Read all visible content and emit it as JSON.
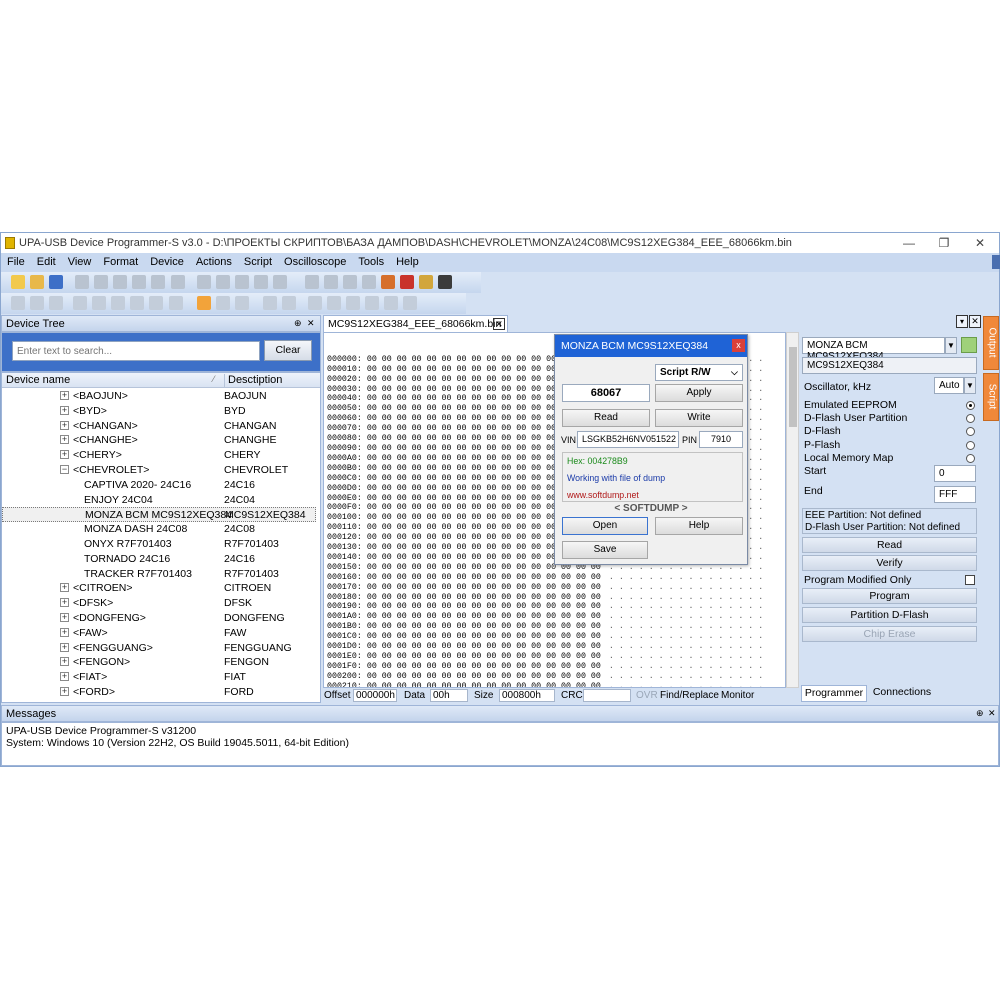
{
  "window": {
    "title": "UPA-USB Device Programmer-S v3.0 - D:\\ПРОЕКТЫ СКРИПТОВ\\БАЗА ДАМПОВ\\DASH\\CHEVROLET\\MONZA\\24C08\\MC9S12XEG384_EEE_68066km.bin",
    "minimize": "—",
    "maximize": "❐",
    "close": "✕"
  },
  "menu": [
    "File",
    "Edit",
    "View",
    "Format",
    "Device",
    "Actions",
    "Script",
    "Oscilloscope",
    "Tools",
    "Help"
  ],
  "device_tree": {
    "title": "Device Tree",
    "pin": "⊕",
    "close": "✕",
    "search_placeholder": "Enter text to search...",
    "clear_label": "Clear",
    "col_name": "Device name",
    "col_desc": "Desctiption",
    "rows": [
      {
        "name": "<BAOJUN>",
        "desc": "BAOJUN",
        "level": 0,
        "exp": "+"
      },
      {
        "name": "<BYD>",
        "desc": "BYD",
        "level": 0,
        "exp": "+"
      },
      {
        "name": "<CHANGAN>",
        "desc": "CHANGAN",
        "level": 0,
        "exp": "+"
      },
      {
        "name": "<CHANGHE>",
        "desc": "CHANGHE",
        "level": 0,
        "exp": "+"
      },
      {
        "name": "<CHERY>",
        "desc": "CHERY",
        "level": 0,
        "exp": "+"
      },
      {
        "name": "<CHEVROLET>",
        "desc": "CHEVROLET",
        "level": 0,
        "exp": "−"
      },
      {
        "name": "CAPTIVA 2020- 24C16",
        "desc": "24C16",
        "level": 1,
        "exp": ""
      },
      {
        "name": "ENJOY 24C04",
        "desc": "24C04",
        "level": 1,
        "exp": ""
      },
      {
        "name": "MONZA BCM MC9S12XEQ384",
        "desc": "MC9S12XEQ384",
        "level": 1,
        "exp": "",
        "selected": true
      },
      {
        "name": "MONZA DASH 24C08",
        "desc": "24C08",
        "level": 1,
        "exp": ""
      },
      {
        "name": "ONYX R7F701403",
        "desc": "R7F701403",
        "level": 1,
        "exp": ""
      },
      {
        "name": "TORNADO 24C16",
        "desc": "24C16",
        "level": 1,
        "exp": ""
      },
      {
        "name": "TRACKER R7F701403",
        "desc": "R7F701403",
        "level": 1,
        "exp": ""
      },
      {
        "name": "<CITROEN>",
        "desc": "CITROEN",
        "level": 0,
        "exp": "+"
      },
      {
        "name": "<DFSK>",
        "desc": "DFSK",
        "level": 0,
        "exp": "+"
      },
      {
        "name": "<DONGFENG>",
        "desc": "DONGFENG",
        "level": 0,
        "exp": "+"
      },
      {
        "name": "<FAW>",
        "desc": "FAW",
        "level": 0,
        "exp": "+"
      },
      {
        "name": "<FENGGUANG>",
        "desc": "FENGGUANG",
        "level": 0,
        "exp": "+"
      },
      {
        "name": "<FENGON>",
        "desc": "FENGON",
        "level": 0,
        "exp": "+"
      },
      {
        "name": "<FIAT>",
        "desc": "FIAT",
        "level": 0,
        "exp": "+"
      },
      {
        "name": "<FORD>",
        "desc": "FORD",
        "level": 0,
        "exp": "+"
      }
    ]
  },
  "editor": {
    "tab_label": "MC9S12XEG384_EEE_68066km.bin",
    "tab_close": "✕",
    "addresses": [
      "000000:",
      "000010:",
      "000020:",
      "000030:",
      "000040:",
      "000050:",
      "000060:",
      "000070:",
      "000080:",
      "000090:",
      "0000A0:",
      "0000B0:",
      "0000C0:",
      "0000D0:",
      "0000E0:",
      "0000F0:",
      "000100:",
      "000110:",
      "000120:",
      "000130:",
      "000140:",
      "000150:",
      "000160:",
      "000170:",
      "000180:",
      "000190:",
      "0001A0:",
      "0001B0:",
      "0001C0:",
      "0001D0:",
      "0001E0:",
      "0001F0:",
      "000200:",
      "000210:",
      "000220:"
    ],
    "hex_row": "00 00 00 00 00 00 00 00 00 00 00 00 00 00 00 00",
    "ascii_row": ". . . . . . . . . . . . . . . .",
    "status": {
      "offset_label": "Offset",
      "offset_value": "000000h",
      "data_label": "Data",
      "data_value": "00h",
      "size_label": "Size",
      "size_value": "000800h",
      "crc_label": "CRC",
      "crc_value": "",
      "ovr": "OVR",
      "find_replace": "Find/Replace",
      "monitor": "Monitor"
    }
  },
  "dialog": {
    "title": "MONZA BCM MC9S12XEQ384",
    "close": "x",
    "mode": "Script R/W",
    "value": "68067",
    "apply": "Apply",
    "read": "Read",
    "write": "Write",
    "vin_label": "VIN",
    "vin_value": "LSGKB52H6NV051522",
    "pin_label": "PIN",
    "pin_value": "7910",
    "info_hex": "Hex: 004278B9",
    "info_working": "Working with file of dump",
    "info_site": "www.softdump.net",
    "brand": "< SOFTDUMP >",
    "open": "Open",
    "help": "Help",
    "save": "Save",
    "colors": {
      "hex": "#1a8a1a",
      "working": "#1a3aa8",
      "site": "#b01818"
    }
  },
  "right_panel": {
    "device_select": "MONZA BCM MC9S12XEQ384",
    "chip": "MC9S12XEQ384",
    "oscillator_label": "Oscillator, kHz",
    "oscillator_value": "Auto",
    "options": [
      {
        "label": "Emulated EEPROM",
        "on": true
      },
      {
        "label": "D-Flash User Partition",
        "on": false
      },
      {
        "label": "D-Flash",
        "on": false
      },
      {
        "label": "P-Flash",
        "on": false
      },
      {
        "label": "Local Memory Map",
        "on": false
      }
    ],
    "start_label": "Start",
    "start_value": "0",
    "end_label": "End",
    "end_value": "FFF",
    "eee_partition": "EEE Partition: Not defined",
    "dflash_partition": "D-Flash User Partition: Not defined",
    "read": "Read",
    "verify": "Verify",
    "program_modified": "Program Modified Only",
    "program": "Program",
    "partition_dflash": "Partition D-Flash",
    "chip_erase": "Chip Erase",
    "tab_programmer": "Programmer",
    "tab_connections": "Connections",
    "side_output": "Output",
    "side_script": "Script"
  },
  "messages": {
    "title": "Messages",
    "lines": [
      "UPA-USB Device Programmer-S v31200",
      "System: Windows 10 (Version 22H2, OS Build 19045.5011, 64-bit Edition)"
    ]
  }
}
